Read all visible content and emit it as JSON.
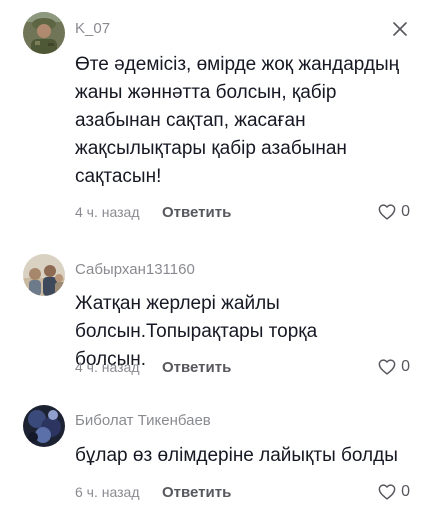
{
  "comments": [
    {
      "username": "K_07",
      "avatar": "military-avatar",
      "text": "Өте әдемісіз, өмірде жоқ жандардың жаны жәннәтта болсын, қабір азабынан сақтап, жасаған жақсылықтары қабір азабынан сақтасын!",
      "time": "4 ч. назад",
      "reply_label": "Ответить",
      "likes": "0",
      "more_icon": "close-icon"
    },
    {
      "username": "Сабырхан131160",
      "avatar": "family-photo-avatar",
      "text": "Жатқан жерлері жайлы болсын.Топырақтары торқа болсын.",
      "time": "4 ч. назад",
      "reply_label": "Ответить",
      "likes": "0"
    },
    {
      "username": "Биболат Тикенбаев",
      "avatar": "dark-blue-avatar",
      "text": "бұлар өз өлімдеріне лайықты болды",
      "time": "6 ч. назад",
      "reply_label": "Ответить",
      "likes": "0"
    }
  ],
  "colors": {
    "text": "#161823",
    "secondary": "#8a8b91",
    "action": "#57585e",
    "background": "#ffffff"
  },
  "icons": [
    "close-icon",
    "heart-icon"
  ]
}
